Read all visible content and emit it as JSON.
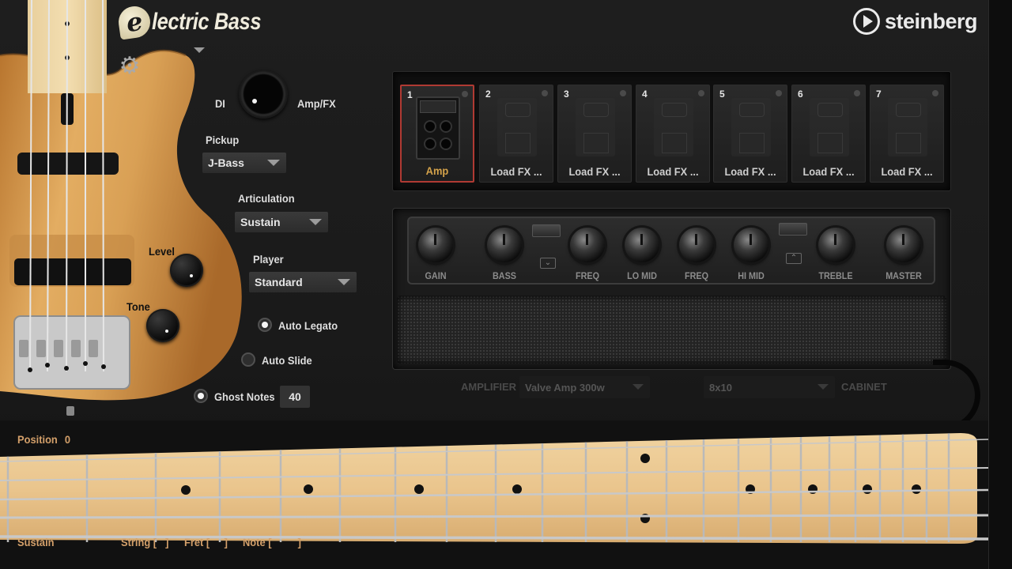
{
  "header": {
    "logo_letter": "e",
    "logo_title": "lectric Bass",
    "brand": "steinberg",
    "icons": [
      "gear-icon",
      "chevron-down-icon",
      "steinberg-play-icon"
    ]
  },
  "output": {
    "di_label": "DI",
    "ampfx_label": "Amp/FX"
  },
  "pickup": {
    "label": "Pickup",
    "value": "J-Bass"
  },
  "articulation": {
    "label": "Articulation",
    "value": "Sustain"
  },
  "player": {
    "label": "Player",
    "value": "Standard"
  },
  "level_label": "Level",
  "tone_label": "Tone",
  "options": {
    "auto_legato": {
      "label": "Auto Legato",
      "checked": true
    },
    "auto_slide": {
      "label": "Auto Slide",
      "checked": false
    },
    "ghost_notes": {
      "label": "Ghost Notes",
      "checked": true,
      "value": "40"
    }
  },
  "fx_slots": [
    {
      "num": "1",
      "label": "Amp",
      "active": true
    },
    {
      "num": "2",
      "label": "Load FX ...",
      "active": false
    },
    {
      "num": "3",
      "label": "Load FX ...",
      "active": false
    },
    {
      "num": "4",
      "label": "Load FX ...",
      "active": false
    },
    {
      "num": "5",
      "label": "Load FX ...",
      "active": false
    },
    {
      "num": "6",
      "label": "Load FX ...",
      "active": false
    },
    {
      "num": "7",
      "label": "Load FX ...",
      "active": false
    }
  ],
  "amp_knobs": [
    "GAIN",
    "BASS",
    "FREQ",
    "LO MID",
    "FREQ",
    "HI MID",
    "TREBLE",
    "MASTER"
  ],
  "amplifier": {
    "label": "AMPLIFIER",
    "value": "Valve Amp 300w"
  },
  "cabinet": {
    "label": "CABINET",
    "value": "8x10"
  },
  "fretboard": {
    "position_label": "Position",
    "position_value": "0",
    "mode": "Sustain",
    "string_label": "String [",
    "string_close": "]",
    "fret_label": "Fret [",
    "fret_close": "]",
    "note_label": "Note [",
    "note_close": "]"
  },
  "colors": {
    "accent_orange": "#d4a06a",
    "active_slot_border": "#b03a33",
    "amp_label_gold": "#d4a24a",
    "maple": "#e9c48f",
    "body_wood": "#d49a4c"
  }
}
